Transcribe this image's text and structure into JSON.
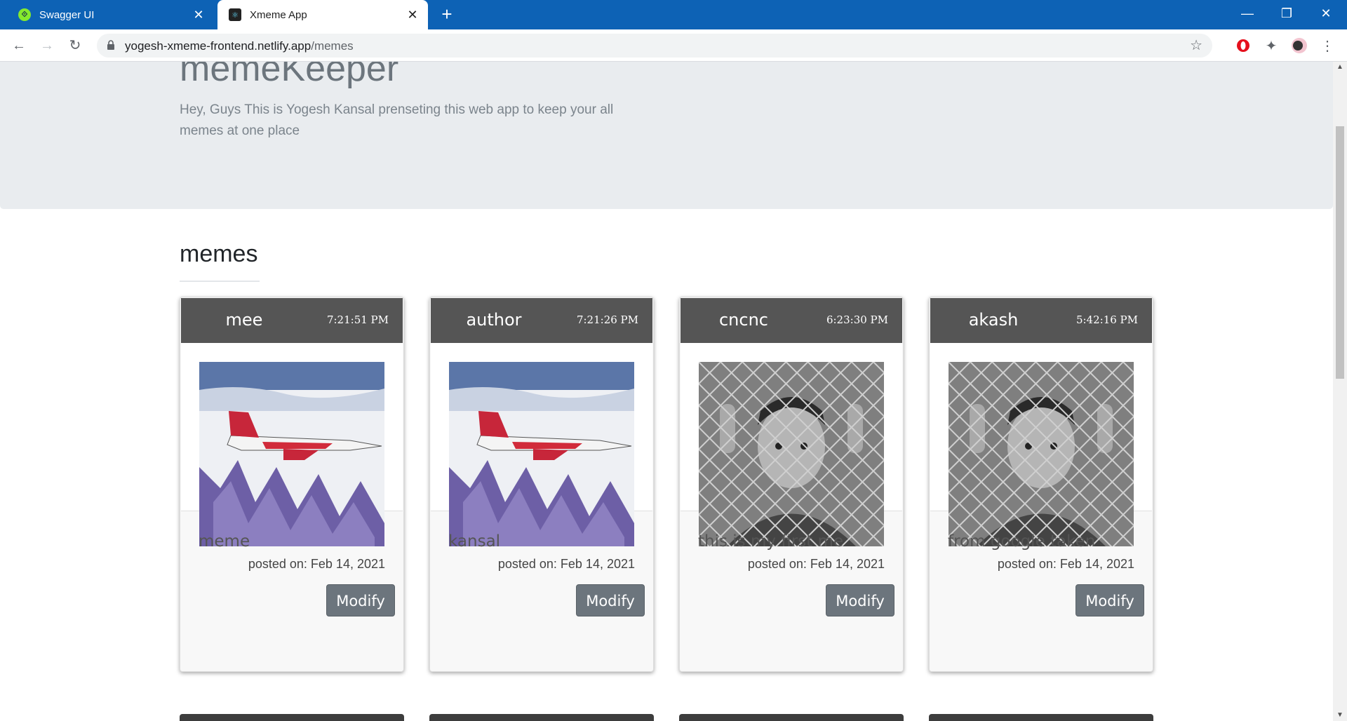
{
  "browser": {
    "tabs": [
      {
        "label": "Swagger UI",
        "icon": "swagger-icon",
        "active": false
      },
      {
        "label": "Xmeme App",
        "icon": "react-icon",
        "active": true
      }
    ],
    "new_tab": "+",
    "url_host": "yogesh-xmeme-frontend.netlify.app",
    "url_path": "/memes"
  },
  "header": {
    "brand": "memeKeeper",
    "lead": "Hey, Guys This is Yogesh Kansal prenseting this web app to keep your all memes at one place"
  },
  "section": {
    "title": "memes"
  },
  "cards": [
    {
      "name": "mee",
      "time": "7:21:51 PM",
      "caption": "meme",
      "posted": "posted on: Feb 14, 2021",
      "modify": "Modify",
      "image": "fighter-jet"
    },
    {
      "name": "author",
      "time": "7:21:26 PM",
      "caption": "kansal",
      "posted": "posted on: Feb 14, 2021",
      "modify": "Modify",
      "image": "fighter-jet"
    },
    {
      "name": "cncnc",
      "time": "6:23:30 PM",
      "caption": "this is my first me",
      "posted": "posted on: Feb 14, 2021",
      "modify": "Modify",
      "image": "boy-behind-fence"
    },
    {
      "name": "akash",
      "time": "5:42:16 PM",
      "caption": "from google taken",
      "posted": "posted on: Feb 14, 2021",
      "modify": "Modify",
      "image": "boy-behind-fence"
    }
  ],
  "colors": {
    "tabbar": "#0d62b5",
    "jumbotron": "#e9ecef",
    "card_header": "#555555",
    "button": "#6c757d"
  }
}
